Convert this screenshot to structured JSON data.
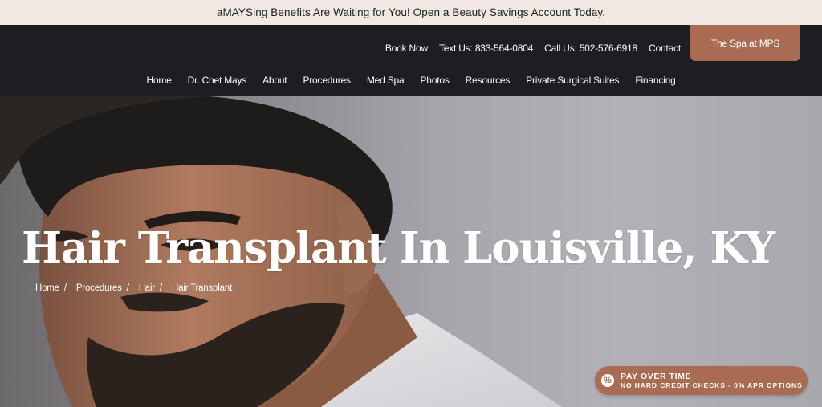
{
  "promo": {
    "text": "aMAYSing Benefits Are Waiting for You! Open a Beauty Savings Account Today."
  },
  "utility_nav": {
    "items": [
      {
        "label": "Book Now"
      },
      {
        "label": "Text Us: 833-564-0804"
      },
      {
        "label": "Call Us: 502-576-6918"
      },
      {
        "label": "Contact"
      }
    ],
    "spa_button": "The Spa at MPS"
  },
  "main_nav": {
    "items": [
      {
        "label": "Home"
      },
      {
        "label": "Dr. Chet Mays"
      },
      {
        "label": "About"
      },
      {
        "label": "Procedures"
      },
      {
        "label": "Med Spa"
      },
      {
        "label": "Photos"
      },
      {
        "label": "Resources"
      },
      {
        "label": "Private Surgical Suites"
      },
      {
        "label": "Financing"
      }
    ]
  },
  "hero": {
    "title": "Hair Transplant In Louisville, KY",
    "breadcrumb": [
      {
        "label": "Home"
      },
      {
        "label": "Procedures"
      },
      {
        "label": "Hair"
      },
      {
        "label": "Hair Transplant"
      }
    ],
    "separator": "/"
  },
  "pay_widget": {
    "icon": "percent-icon",
    "icon_glyph": "%",
    "title": "PAY OVER TIME",
    "subtitle": "NO HARD CREDIT CHECKS - 0% APR OPTIONS"
  },
  "colors": {
    "accent": "#a96b52",
    "header_bg": "#1c1e22",
    "promo_bg": "#efe9e2"
  }
}
